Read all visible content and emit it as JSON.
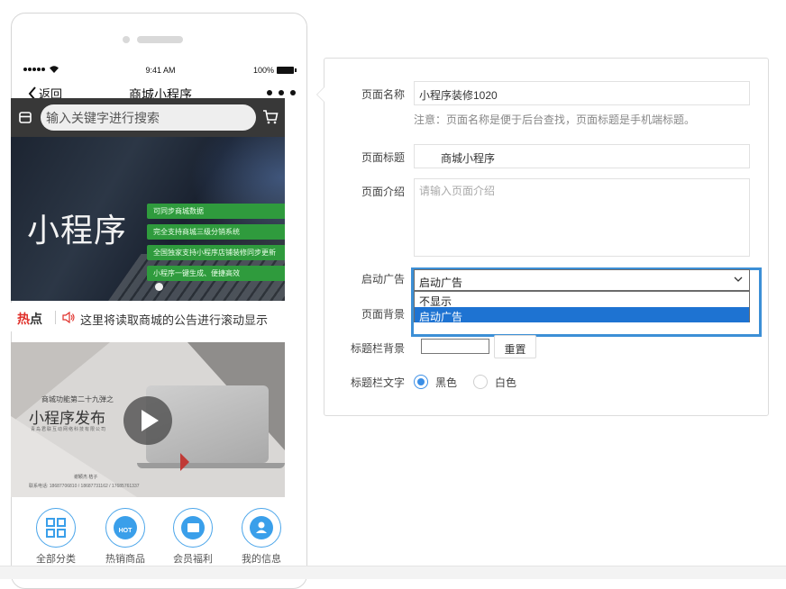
{
  "status_bar": {
    "time": "9:41 AM",
    "battery": "100%"
  },
  "nav": {
    "back_label": "返回",
    "title": "商城小程序"
  },
  "search": {
    "placeholder": "输入关键字进行搜索"
  },
  "banner": {
    "title": "小程序",
    "items": [
      "可同步商城数据",
      "完全支持商城三级分销系统",
      "全国独家支持小程序店铺装修同步更新",
      "小程序一键生成、便捷高效"
    ]
  },
  "notice": {
    "hot_red": "热",
    "hot_black": "点",
    "text": "这里将读取商城的公告进行滚动显示"
  },
  "video": {
    "small_title": "商城功能第二十九弹之",
    "big_title": "小程序发布",
    "sub": "青岛君联互动网络科技有限公司",
    "people": "谢颖杰  桔子",
    "footer": "联系电话: 18687706810 / 18687731162 / 17685761337"
  },
  "categories": [
    {
      "icon": "grid-icon",
      "label": "全部分类"
    },
    {
      "icon": "hot-icon",
      "label": "热销商品"
    },
    {
      "icon": "wallet-icon",
      "label": "会员福利"
    },
    {
      "icon": "user-icon",
      "label": "我的信息"
    }
  ],
  "form": {
    "page_name_label": "页面名称",
    "page_name_value": "小程序装修1020",
    "page_name_hint": "注意：页面名称是便于后台查找，页面标题是手机端标题。",
    "page_title_label": "页面标题",
    "page_title_value": "商城小程序",
    "page_intro_label": "页面介绍",
    "page_intro_placeholder": "请输入页面介绍",
    "ad_label": "启动广告",
    "ad_selected": "启动广告",
    "ad_options": [
      "不显示",
      "启动广告"
    ],
    "bg_label": "页面背景",
    "titlebar_bg_label": "标题栏背景",
    "reset_label": "重置",
    "titlebar_text_label": "标题栏文字",
    "text_color_options": [
      "黑色",
      "白色"
    ],
    "text_color_selected": "黑色"
  },
  "colors": {
    "accent": "#3a8ee6",
    "select_highlight": "#1e73d2",
    "hot_red": "#e0302a",
    "banner_green": "#2f9b3d"
  }
}
